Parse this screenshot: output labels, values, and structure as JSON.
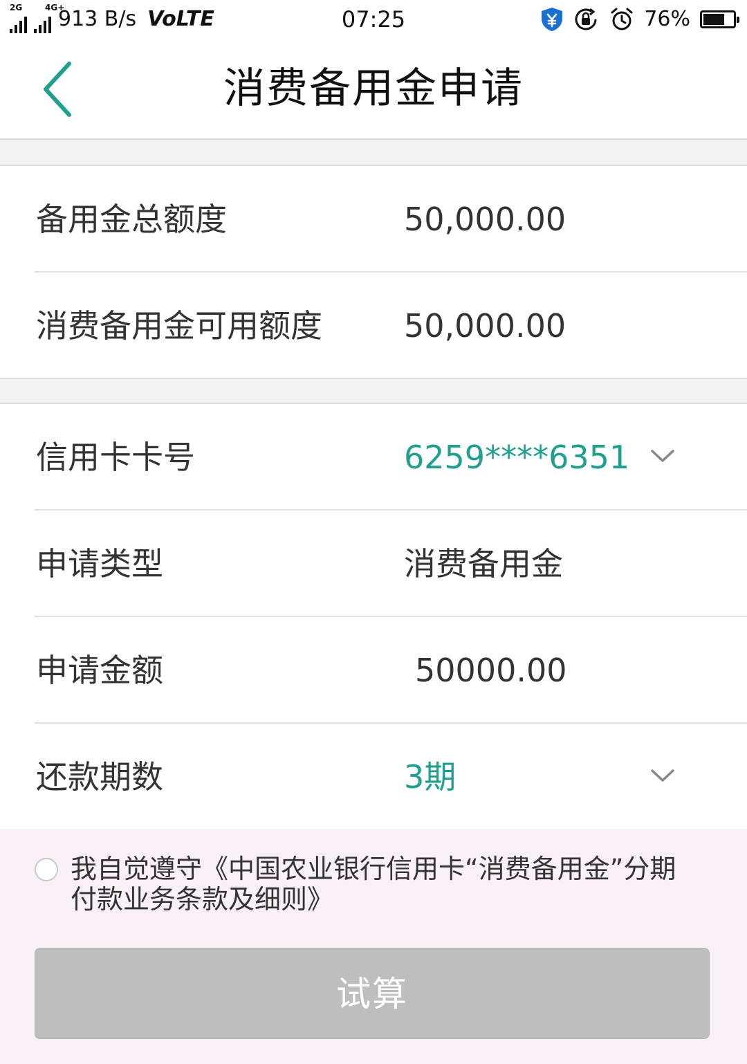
{
  "status_bar": {
    "network1": "2G",
    "network2": "4G+",
    "speed": "913 B/s",
    "volte": "VoLTE",
    "time": "07:25",
    "battery": "76%",
    "battery_level": 0.76,
    "icons": [
      "security-shield-icon",
      "rotation-lock-icon",
      "alarm-icon",
      "battery-icon"
    ]
  },
  "header": {
    "title": "消费备用金申请",
    "back_icon": "chevron-left-icon"
  },
  "quota": {
    "rows": [
      {
        "label": "备用金总额度",
        "value": "50,000.00"
      },
      {
        "label": "消费备用金可用额度",
        "value": "50,000.00"
      }
    ]
  },
  "form": {
    "card": {
      "label": "信用卡卡号",
      "value": "6259****6351"
    },
    "type": {
      "label": "申请类型",
      "value": "消费备用金"
    },
    "amount": {
      "label": "申请金额",
      "value": "50000.00"
    },
    "periods": {
      "label": "还款期数",
      "value": "3期"
    }
  },
  "agreement": {
    "text_prefix": "我自觉遵守",
    "link_text": "《中国农业银行信用卡“消费备用金”分期付款业务条款及细则》"
  },
  "actions": {
    "calc_label": "试算"
  },
  "colors": {
    "accent": "#1fa08e",
    "button_disabled": "#bebebe",
    "bottom_background": "#f8f0f6"
  }
}
